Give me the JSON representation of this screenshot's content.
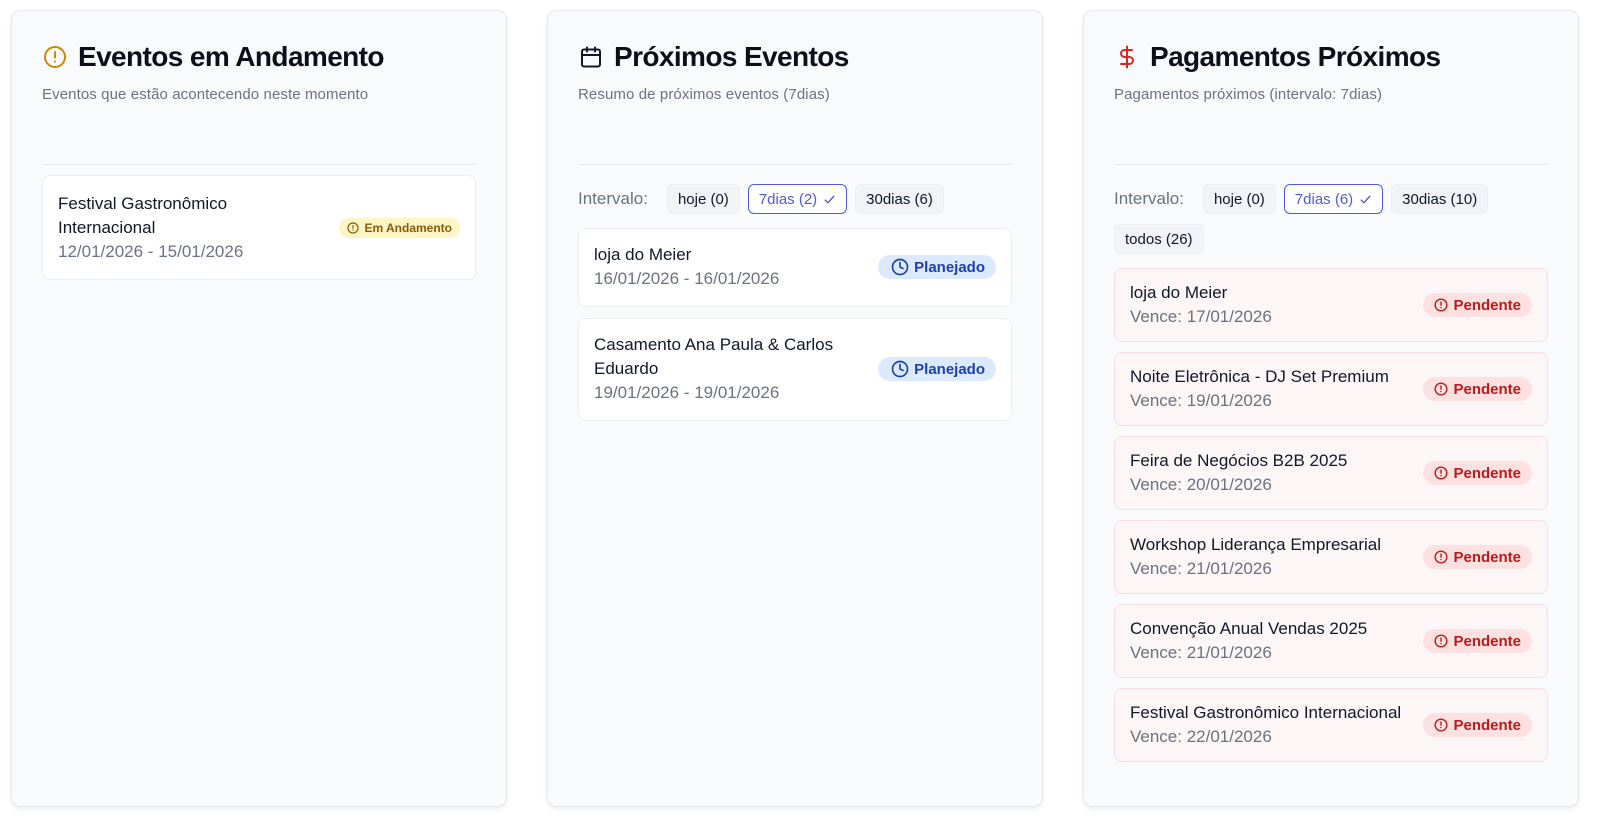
{
  "colors": {
    "accent_active_chip": "#4f5bd5",
    "in_progress_icon": "#ca8a04",
    "calendar_icon": "#111827",
    "dollar_icon": "#dc2626",
    "badge_yellow": "#fdf5c4",
    "badge_blue": "#dbeafe",
    "badge_red": "#fde0e0"
  },
  "andamento": {
    "title": "Eventos em Andamento",
    "icon": "alert-circle-icon",
    "subtitle": "Eventos que estão acontecendo neste momento",
    "items": [
      {
        "title_line1": "Festival Gastronômico",
        "title_line2": "Internacional",
        "dates": "12/01/2026 - 15/01/2026",
        "status": "Em Andamento"
      }
    ]
  },
  "proximos": {
    "title": "Próximos Eventos",
    "icon": "calendar-icon",
    "subtitle": "Resumo de próximos eventos (7dias)",
    "filter_label": "Intervalo:",
    "filters": [
      "hoje (0)",
      "7dias (2)",
      "30dias (6)"
    ],
    "active_filter": "7dias (2)",
    "items": [
      {
        "title_line1": "loja do Meier",
        "title_line2": "",
        "dates": "16/01/2026 - 16/01/2026",
        "status": "Planejado"
      },
      {
        "title_line1": "Casamento Ana Paula & Carlos",
        "title_line2": "Eduardo",
        "dates": "19/01/2026 - 19/01/2026",
        "status": "Planejado"
      }
    ]
  },
  "pagamentos": {
    "title": "Pagamentos Próximos",
    "icon": "dollar-sign-icon",
    "subtitle": "Pagamentos próximos (intervalo: 7dias)",
    "filter_label": "Intervalo:",
    "filters": [
      "hoje (0)",
      "7dias (6)",
      "30dias (10)",
      "todos (26)"
    ],
    "active_filter": "7dias (6)",
    "items": [
      {
        "title": "loja do Meier",
        "due": "Vence: 17/01/2026",
        "status": "Pendente"
      },
      {
        "title": "Noite Eletrônica - DJ Set Premium",
        "due": "Vence: 19/01/2026",
        "status": "Pendente"
      },
      {
        "title": "Feira de Negócios B2B 2025",
        "due": "Vence: 20/01/2026",
        "status": "Pendente"
      },
      {
        "title": "Workshop Liderança Empresarial",
        "due": "Vence: 21/01/2026",
        "status": "Pendente"
      },
      {
        "title": "Convenção Anual Vendas 2025",
        "due": "Vence: 21/01/2026",
        "status": "Pendente"
      },
      {
        "title": "Festival Gastronômico Internacional",
        "due": "Vence: 22/01/2026",
        "status": "Pendente"
      }
    ]
  }
}
